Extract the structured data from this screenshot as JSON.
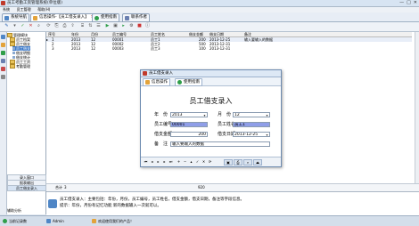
{
  "window": {
    "title": "员工考勤工资管理系统(单位版)",
    "controls": [
      "—",
      "□",
      "✕"
    ]
  },
  "menu": [
    "系统",
    "员工管理",
    "帮助(H)"
  ],
  "tabs": [
    {
      "label": "系统导航",
      "icon": "home-icon"
    },
    {
      "label": "信息操作-【员工借支录入】",
      "icon": "edit-icon"
    },
    {
      "label": "使用指南",
      "icon": "help-icon"
    },
    {
      "label": "联系作者",
      "icon": "contact-icon"
    }
  ],
  "sidebar": {
    "tree": [
      {
        "label": "管理模块",
        "level": 0
      },
      {
        "label": "员工档案",
        "level": 1
      },
      {
        "label": "员工借支",
        "level": 1
      },
      {
        "label": "员工借支",
        "level": 2
      },
      {
        "label": "借支明细",
        "level": 2
      },
      {
        "label": "借支统计",
        "level": 2
      },
      {
        "label": "员工工资",
        "level": 1
      },
      {
        "label": "考勤管理",
        "level": 1
      }
    ],
    "nav_buttons": [
      "录入窗口",
      "报表输出",
      "员工借支录入"
    ],
    "bottom_link": "辅助分析"
  },
  "grid": {
    "columns": [
      "序号",
      "年份",
      "月份",
      "员工编号",
      "员工姓名",
      "借支金额",
      "借支日期",
      "备注"
    ],
    "rows": [
      [
        "1",
        "2013",
        "12",
        "00001",
        "员工1",
        "200",
        "2013-12-25",
        "输入要输入的数据"
      ],
      [
        "2",
        "2013",
        "12",
        "00002",
        "员工2",
        "500",
        "2013-12-31",
        ""
      ],
      [
        "3",
        "2013",
        "12",
        "00003",
        "员工3",
        "100",
        "2013-12-31",
        ""
      ]
    ],
    "footer_count": "3",
    "footer_total": "920",
    "footer_label": "合计"
  },
  "dialog": {
    "title": "员工借支录入",
    "tabs": [
      "信息操作",
      "使用指南"
    ],
    "heading": "员工借支录入",
    "fields": {
      "year_label": "年　份",
      "year_value": "2013",
      "month_label": "月　份",
      "month_value": "12",
      "emp_id_label": "员工编号",
      "emp_id_value": "00001",
      "emp_name_label": "员工姓名",
      "emp_name_value": "员工1",
      "amount_label": "借支金额",
      "amount_value": "200",
      "date_label": "借支日期",
      "date_value": "2013-12-25",
      "note_label": "备　注",
      "note_value": "输入要输入的数据"
    }
  },
  "hint": {
    "line1": "员工借支录入：主要包括：年份，月份，员工编号，员工姓名，借支金额，借支日期，备注等字段信息。",
    "line2": "提示：年份，月份有记忆功能 新的数据输入一次就可以。"
  },
  "status": {
    "left": "当前记录数",
    "user": "Admin",
    "message": "欢迎使用我们的产品！"
  },
  "colors": {
    "accent": "#3a78c8",
    "highlight_field": "#8f9ee8"
  }
}
